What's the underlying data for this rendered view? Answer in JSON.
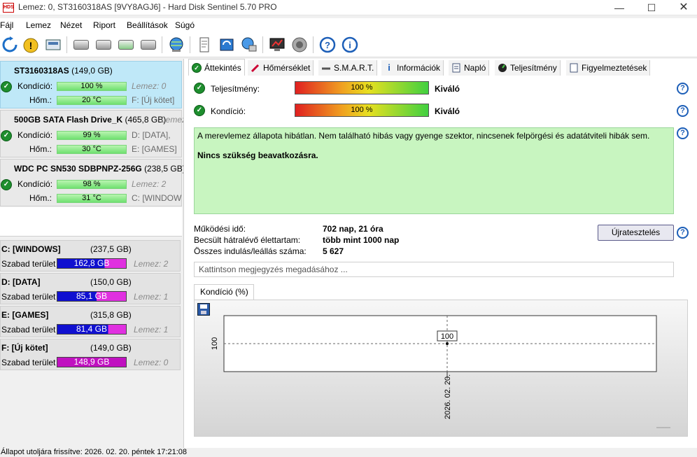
{
  "window": {
    "title": "Lemez: 0, ST3160318AS [9VY8AGJ6]  -  Hard Disk Sentinel 5.70 PRO",
    "app_icon_text": "HDS"
  },
  "menu": [
    {
      "label": "Fájl"
    },
    {
      "label": "Lemez"
    },
    {
      "label": "Nézet"
    },
    {
      "label": "Riport"
    },
    {
      "label": "Beállítások"
    },
    {
      "label": "Súgó"
    }
  ],
  "disks": [
    {
      "name": "ST3160318AS",
      "size": "(149,0 GB)",
      "cond_label": "Kondíció:",
      "cond_value": "100 %",
      "cond_right": "Lemez: 0",
      "temp_label": "Hőm.:",
      "temp_value": "20 °C",
      "temp_right": "F: [Új kötet]"
    },
    {
      "name": "500GB SATA Flash Drive_K",
      "size": "(465,8 GB)",
      "name_right": "Lemez",
      "cond_label": "Kondíció:",
      "cond_value": "99 %",
      "cond_right": "D: [DATA],",
      "temp_label": "Hőm.:",
      "temp_value": "30 °C",
      "temp_right": "E: [GAMES]"
    },
    {
      "name": "WDC PC SN530 SDBPNPZ-256G",
      "size": "(238,5 GB)",
      "cond_label": "Kondíció:",
      "cond_value": "98 %",
      "cond_right": "Lemez: 2",
      "temp_label": "Hőm.:",
      "temp_value": "31 °C",
      "temp_right": "C: [WINDOWS"
    }
  ],
  "volumes": [
    {
      "name": "C: [WINDOWS]",
      "size": "(237,5 GB)",
      "free_label": "Szabad terület",
      "free_value": "162,8 GB",
      "disk": "Lemez: 2",
      "color": "#1010d0",
      "free_fraction": 0.69
    },
    {
      "name": "D: [DATA]",
      "size": "(150,0 GB)",
      "free_label": "Szabad terület",
      "free_value": "85,1 GB",
      "disk": "Lemez: 1",
      "color": "#1010d0",
      "free_fraction": 0.57
    },
    {
      "name": "E: [GAMES]",
      "size": "(315,8 GB)",
      "free_label": "Szabad terület",
      "free_value": "81,4 GB",
      "disk": "Lemez: 1",
      "color": "#1010d0",
      "free_fraction": 0.74
    },
    {
      "name": "F: [Új kötet]",
      "size": "(149,0 GB)",
      "free_label": "Szabad terület",
      "free_value": "148,9 GB",
      "disk": "Lemez: 0",
      "color": "#c010c0",
      "free_fraction": 1.0
    }
  ],
  "tabs": [
    {
      "label": "Áttekintés"
    },
    {
      "label": "Hőmérséklet"
    },
    {
      "label": "S.M.A.R.T."
    },
    {
      "label": "Információk"
    },
    {
      "label": "Napló"
    },
    {
      "label": "Teljesítmény"
    },
    {
      "label": "Figyelmeztetések"
    }
  ],
  "overview": {
    "performance_label": "Teljesítmény:",
    "performance_value": "100 %",
    "performance_rating": "Kiváló",
    "health_label": "Kondíció:",
    "health_value": "100 %",
    "health_rating": "Kiváló",
    "status_text": "A merevlemez állapota hibátlan. Nem található hibás vagy gyenge szektor, nincsenek felpörgési és adatátviteli hibák sem.",
    "status_action": "Nincs szükség beavatkozásra.",
    "info": [
      {
        "label": "Működési idő:",
        "value": "702 nap, 21 óra"
      },
      {
        "label": "Becsült hátralévő élettartam:",
        "value": "több mint 1000 nap"
      },
      {
        "label": "Összes indulás/leállás száma:",
        "value": "5 627"
      }
    ],
    "retest_button": "Újratesztelés",
    "note_placeholder": "Kattintson megjegyzés megadásához ...",
    "chart_tab": "Kondíció  (%)"
  },
  "chart_data": {
    "type": "line",
    "title": "Kondíció  (%)",
    "x": [
      "2026. 02. 20."
    ],
    "series": [
      {
        "values": [
          100
        ]
      }
    ],
    "ytick_labels": [
      "100"
    ],
    "data_labels": [
      "100"
    ]
  },
  "statusbar": {
    "text": "Állapot utoljára frissítve: 2026. 02. 20. péntek 17:21:08"
  }
}
